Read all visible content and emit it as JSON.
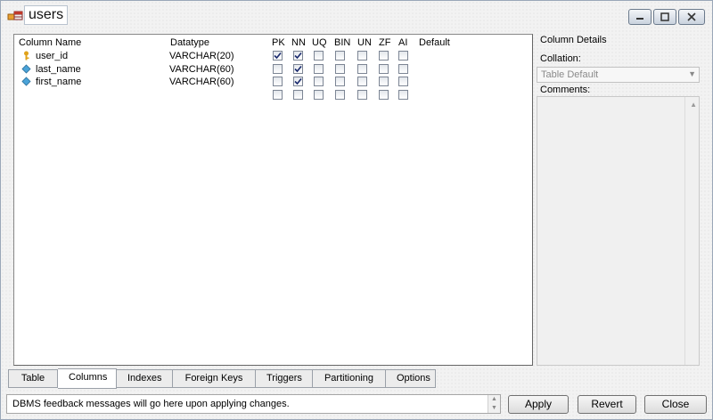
{
  "window": {
    "title": "users"
  },
  "grid": {
    "headers": {
      "column_name": "Column Name",
      "datatype": "Datatype",
      "pk": "PK",
      "nn": "NN",
      "uq": "UQ",
      "bin": "BIN",
      "un": "UN",
      "zf": "ZF",
      "ai": "AI",
      "default": "Default"
    },
    "rows": [
      {
        "name": "user_id",
        "type": "VARCHAR(20)",
        "icon": "key-icon",
        "pk": true,
        "nn": true,
        "uq": false,
        "bin": false,
        "un": false,
        "zf": false,
        "ai": false
      },
      {
        "name": "last_name",
        "type": "VARCHAR(60)",
        "icon": "diamond-column-icon",
        "pk": false,
        "nn": true,
        "uq": false,
        "bin": false,
        "un": false,
        "zf": false,
        "ai": false
      },
      {
        "name": "first_name",
        "type": "VARCHAR(60)",
        "icon": "diamond-column-icon",
        "pk": false,
        "nn": true,
        "uq": false,
        "bin": false,
        "un": false,
        "zf": false,
        "ai": false
      },
      {
        "name": "",
        "type": "",
        "icon": "",
        "pk": false,
        "nn": false,
        "uq": false,
        "bin": false,
        "un": false,
        "zf": false,
        "ai": false
      }
    ]
  },
  "details": {
    "heading": "Column Details",
    "collation_label": "Collation:",
    "collation_value": "Table Default",
    "comments_label": "Comments:"
  },
  "tabs": [
    {
      "label": "Table",
      "active": false
    },
    {
      "label": "Columns",
      "active": true
    },
    {
      "label": "Indexes",
      "active": false
    },
    {
      "label": "Foreign Keys",
      "active": false
    },
    {
      "label": "Triggers",
      "active": false
    },
    {
      "label": "Partitioning",
      "active": false
    },
    {
      "label": "Options",
      "active": false
    }
  ],
  "footer": {
    "feedback": "DBMS feedback messages will go here upon applying changes.",
    "apply_label": "Apply",
    "revert_label": "Revert",
    "close_label": "Close"
  },
  "colors": {
    "key_icon": "#e0a21a",
    "column_icon": "#4aa3d8",
    "check": "#1b2b6e"
  }
}
